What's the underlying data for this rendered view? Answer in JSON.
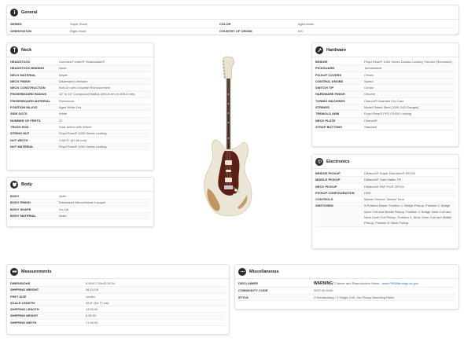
{
  "general": {
    "title": "General",
    "rows": [
      {
        "k1": "SERIES",
        "v1": "Super Stock",
        "k2": "COLOR",
        "v2": "Aged Arctic"
      },
      {
        "k1": "ORIENTATION",
        "v1": "Right-Hand",
        "k2": "COUNTRY OF ORIGIN",
        "v2": "MX"
      }
    ]
  },
  "neck": {
    "title": "Neck",
    "rows": [
      {
        "k": "HEADSTOCK",
        "v": "Licensed Fender® Stratocaster®"
      },
      {
        "k": "HEADSTOCK BINDING",
        "v": "None"
      },
      {
        "k": "NECK MATERIAL",
        "v": "Maple"
      },
      {
        "k": "NECK FINISH",
        "v": "Distressed Urethane"
      },
      {
        "k": "NECK CONSTRUCTION",
        "v": "Bolt-On with Graphite Reinforcement"
      },
      {
        "k": "FINGERBOARD RADIUS",
        "v": "12\" to 16\" Compound Radius (304.8 mm to 406.4 mm)"
      },
      {
        "k": "FINGERBOARD MATERIAL",
        "v": "Rosewood"
      },
      {
        "k": "POSITION INLAYS",
        "v": "Aged White Dot"
      },
      {
        "k": "SIDE DOTS",
        "v": "White"
      },
      {
        "k": "NUMBER OF FRETS",
        "v": "22"
      },
      {
        "k": "TRUSS ROD",
        "v": "Dual-Action with Wheel"
      },
      {
        "k": "STRING NUT",
        "v": "Floyd Rose® 1000 Series Locking"
      },
      {
        "k": "NUT WIDTH",
        "v": "1.6875\" (42.86 mm)"
      },
      {
        "k": "NUT MATERIAL",
        "v": "Floyd Rose® 1000 Series Locking"
      }
    ]
  },
  "body_card": {
    "title": "Body",
    "rows": [
      {
        "k": "BODY",
        "v": "Alder"
      },
      {
        "k": "BODY FINISH",
        "v": "Distressed Nitrocellulose Lacquer"
      },
      {
        "k": "BODY SHAPE",
        "v": "So-Cal"
      },
      {
        "k": "BODY MATERIAL",
        "v": "Alder"
      }
    ]
  },
  "hardware": {
    "title": "Hardware",
    "rows": [
      {
        "k": "BRIDGE",
        "v": "Floyd Rose® 1000 Series Double-Locking Tremolo (Recessed)"
      },
      {
        "k": "PICKGUARD",
        "v": "Tortoiseshell"
      },
      {
        "k": "PICKUP COVERS",
        "v": "Cream"
      },
      {
        "k": "CONTROL KNOBS",
        "v": "Speed"
      },
      {
        "k": "SWITCH TIP",
        "v": "Cream"
      },
      {
        "k": "HARDWARE FINISH",
        "v": "Chrome"
      },
      {
        "k": "TUNING MACHINES",
        "v": "Charvel®-Branded Die-Cast"
      },
      {
        "k": "STRINGS",
        "v": "Nickel Plated Steel (.009-.042 Gauges)"
      },
      {
        "k": "TREMOLO ARM",
        "v": "Floyd Rose® FRT-O1000 Locking"
      },
      {
        "k": "NECK PLATE",
        "v": "Charvel®"
      },
      {
        "k": "STRAP BUTTONS",
        "v": "Standard"
      }
    ]
  },
  "electronics": {
    "title": "Electronics",
    "rows": [
      {
        "k": "BRIDGE PICKUP",
        "v": "DiMarzio® Super Distortion® DP100"
      },
      {
        "k": "MIDDLE PICKUP",
        "v": "DiMarzio® Dark Matter 2®"
      },
      {
        "k": "NECK PICKUP",
        "v": "DiMarzio® PAF Pro® DP151"
      },
      {
        "k": "PICKUP CONFIGURATION",
        "v": "HSH"
      },
      {
        "k": "CONTROLS",
        "v": "Master Volume, Master Tone"
      },
      {
        "k": "SWITCHING",
        "v": "5-Position Blade: Position 1. Bridge Pickup, Position 2. Bridge Inner Coil and Middle Pickup, Position 3. Bridge Inner Coil and Neck Inner Coil Pickup, Position 4. Neck Outer Coil and Middle Pickup, Position 5. Neck Pickup"
      }
    ]
  },
  "measurements": {
    "title": "Measurements",
    "rows": [
      {
        "k": "DIMENSIONS",
        "v": "6.50x17.00x43.50 IN"
      },
      {
        "k": "SHIPPING WEIGHT",
        "v": "16.10 LB"
      },
      {
        "k": "FRET SIZE",
        "v": "Jumbo"
      },
      {
        "k": "SCALE LENGTH",
        "v": "25.5\" (64.77 cm)"
      },
      {
        "k": "SHIPPING LENGTH",
        "v": "43.50 IN"
      },
      {
        "k": "SHIPPING HEIGHT",
        "v": "6.50 IN"
      },
      {
        "k": "SHIPPING WIDTH",
        "v": "17.00 IN"
      }
    ]
  },
  "misc": {
    "title": "Miscellaneous",
    "disclaimer_k": "DISCLAIMER",
    "disclaimer_warn": "WARNING:",
    "disclaimer_text": " Cancer and Reproductive Harm - ",
    "disclaimer_link": "www.P65Warnings.ca.gov.",
    "rows": [
      {
        "k": "COMMODITY CODE",
        "v": "9207.90.0040"
      },
      {
        "k": "STYLE",
        "v": "2 Humbucking / 1 Single-Coil - No Pickup Mounting Holes"
      }
    ]
  },
  "colors": {
    "icon_bg": "#2b2b2b",
    "link": "#2a6fb5",
    "guitar_body": "#ece6d6",
    "pickguard": "#5a1f16",
    "fretboard": "#3a2216"
  }
}
